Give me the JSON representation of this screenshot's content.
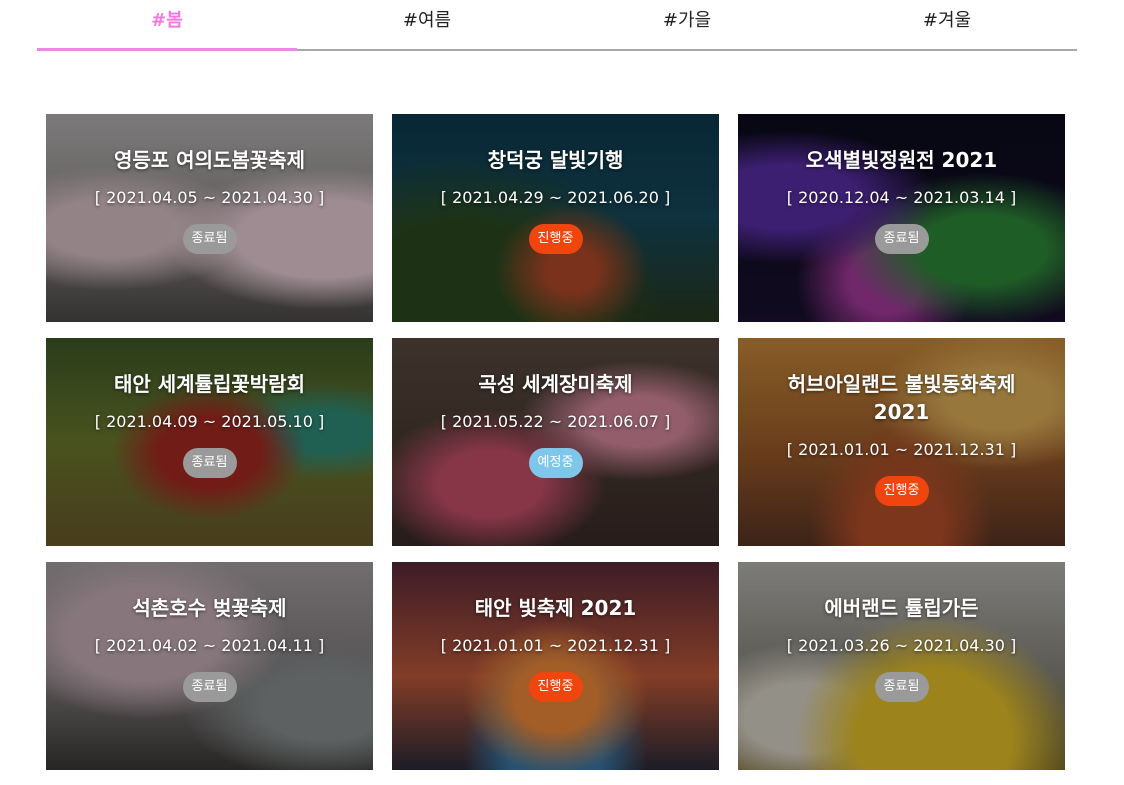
{
  "tabs": [
    {
      "label": "#봄",
      "active": true
    },
    {
      "label": "#여름",
      "active": false
    },
    {
      "label": "#가을",
      "active": false
    },
    {
      "label": "#겨울",
      "active": false
    }
  ],
  "festivals": [
    {
      "title": "영등포 여의도봄꽃축제",
      "date": "[ 2021.04.05 ~ 2021.04.30 ]",
      "status": "종료됨"
    },
    {
      "title": "창덕궁 달빛기행",
      "date": "[ 2021.04.29 ~ 2021.06.20 ]",
      "status": "진행중"
    },
    {
      "title": "오색별빛정원전 2021",
      "date": "[ 2020.12.04 ~ 2021.03.14 ]",
      "status": "종료됨"
    },
    {
      "title": "태안 세계튤립꽃박람회",
      "date": "[ 2021.04.09 ~ 2021.05.10 ]",
      "status": "종료됨"
    },
    {
      "title": "곡성 세계장미축제",
      "date": "[ 2021.05.22 ~ 2021.06.07 ]",
      "status": "예정중"
    },
    {
      "title": "허브아일랜드 불빛동화축제 2021",
      "date": "[ 2021.01.01 ~ 2021.12.31 ]",
      "status": "진행중"
    },
    {
      "title": "석촌호수 벚꽃축제",
      "date": "[ 2021.04.02 ~ 2021.04.11 ]",
      "status": "종료됨"
    },
    {
      "title": "태안 빛축제 2021",
      "date": "[ 2021.01.01 ~ 2021.12.31 ]",
      "status": "진행중"
    },
    {
      "title": "에버랜드 튤립가든",
      "date": "[ 2021.03.26 ~ 2021.04.30 ]",
      "status": "종료됨"
    }
  ],
  "colors": {
    "active_tab": "#ef7bde",
    "status_ended": "#9a9a9a",
    "status_ongoing": "#f0450e",
    "status_upcoming": "#7ec7ea"
  }
}
